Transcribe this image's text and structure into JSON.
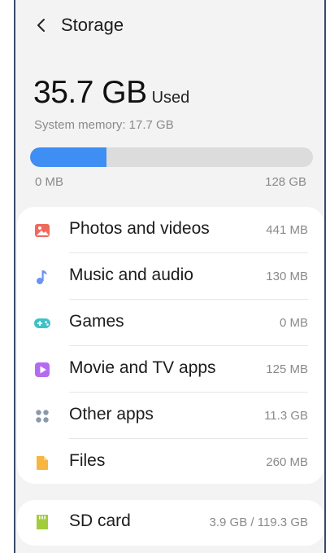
{
  "header": {
    "title": "Storage"
  },
  "usage": {
    "used_value": "35.7 GB",
    "used_unit": "Used",
    "system_memory": "System memory: 17.7 GB",
    "fill_fraction": 0.27,
    "range_min": "0 MB",
    "range_max": "128 GB",
    "bar_color": "#3f8ef3"
  },
  "categories": [
    {
      "label": "Photos and videos",
      "size": "441 MB",
      "icon": "image-icon",
      "color": "#f0695c"
    },
    {
      "label": "Music and audio",
      "size": "130 MB",
      "icon": "music-note-icon",
      "color": "#6c93f2"
    },
    {
      "label": "Games",
      "size": "0 MB",
      "icon": "gamepad-icon",
      "color": "#3cc2c8"
    },
    {
      "label": "Movie and TV apps",
      "size": "125 MB",
      "icon": "play-icon",
      "color": "#b56bef"
    },
    {
      "label": "Other apps",
      "size": "11.3 GB",
      "icon": "apps-grid-icon",
      "color": "#8a99ab"
    },
    {
      "label": "Files",
      "size": "260 MB",
      "icon": "file-icon",
      "color": "#f7b541"
    }
  ],
  "sd_card": {
    "label": "SD card",
    "size": "3.9 GB / 119.3 GB",
    "icon": "sd-card-icon",
    "color": "#a2cc3c"
  }
}
